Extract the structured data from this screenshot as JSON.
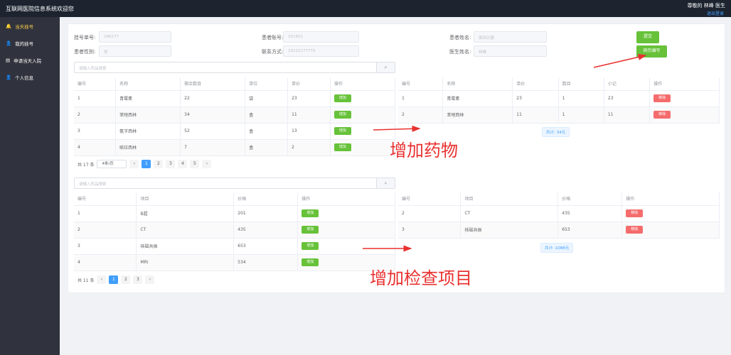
{
  "header": {
    "title": "互联网医院信息系统欢迎您",
    "greeting": "尊敬的 林峰 医生",
    "logout": "退出登录"
  },
  "sidebar": {
    "items": [
      {
        "label": "当天挂号",
        "icon": "bell-icon",
        "active": true
      },
      {
        "label": "我的挂号",
        "icon": "user-icon"
      },
      {
        "label": "申请当天入院",
        "icon": "document-icon"
      },
      {
        "label": "个人信息",
        "icon": "user-icon"
      }
    ]
  },
  "form": {
    "reg_no_label": "挂号单号:",
    "reg_no": "266277",
    "patient_id_label": "患者账号:",
    "patient_id": "201801",
    "patient_name_label": "患者姓名:",
    "patient_name": "面回示器",
    "gender_label": "患者性别:",
    "gender": "男",
    "phone_label": "联系方式:",
    "phone": "18215277779",
    "doctor_label": "医生姓名:",
    "doctor": "林峰",
    "submit": "提交",
    "record": "病历编写"
  },
  "drugs": {
    "search_placeholder": "请输入药品搜索",
    "headers": [
      "编号",
      "名称",
      "剩余数目",
      "单位",
      "单价",
      "操作"
    ],
    "rows": [
      [
        "1",
        "青霉素",
        "22",
        "袋",
        "23"
      ],
      [
        "2",
        "苯唑西林",
        "34",
        "盒",
        "11"
      ],
      [
        "3",
        "氨苄西林",
        "52",
        "盒",
        "13"
      ],
      [
        "4",
        "哌拉西林",
        "7",
        "盒",
        "2"
      ]
    ],
    "add_label": "增加",
    "total_count": "共 17 条",
    "page_size": "4条/页",
    "pages": [
      "1",
      "2",
      "3",
      "4",
      "5"
    ],
    "current_page": "1",
    "cart_headers": [
      "编号",
      "名称",
      "单价",
      "数目",
      "小记",
      "操作"
    ],
    "cart_rows": [
      [
        "1",
        "青霉素",
        "23",
        "1",
        "23"
      ],
      [
        "2",
        "苯唑西林",
        "11",
        "1",
        "11"
      ]
    ],
    "delete_label": "移除",
    "cart_total": "共计: 34元"
  },
  "exams": {
    "search_placeholder": "请输入药品搜索",
    "headers": [
      "编号",
      "项目",
      "价格",
      "操作"
    ],
    "rows": [
      [
        "1",
        "B超",
        "201"
      ],
      [
        "2",
        "CT",
        "435"
      ],
      [
        "3",
        "核磁共振",
        "653"
      ],
      [
        "4",
        "MRI",
        "534"
      ]
    ],
    "add_label": "增加",
    "total_count": "共 11 条",
    "pages": [
      "1",
      "2",
      "3"
    ],
    "current_page": "1",
    "cart_headers": [
      "编号",
      "项目",
      "价格",
      "操作"
    ],
    "cart_rows": [
      [
        "2",
        "CT",
        "435"
      ],
      [
        "3",
        "核磁共振",
        "653"
      ]
    ],
    "delete_label": "移除",
    "cart_total": "共计: 1088元"
  },
  "annotations": {
    "drugs": "增加药物",
    "exams": "增加检查项目"
  },
  "colors": {
    "success": "#67c23a",
    "danger": "#f56c6c",
    "primary": "#409eff",
    "annotation": "#e8312f"
  }
}
